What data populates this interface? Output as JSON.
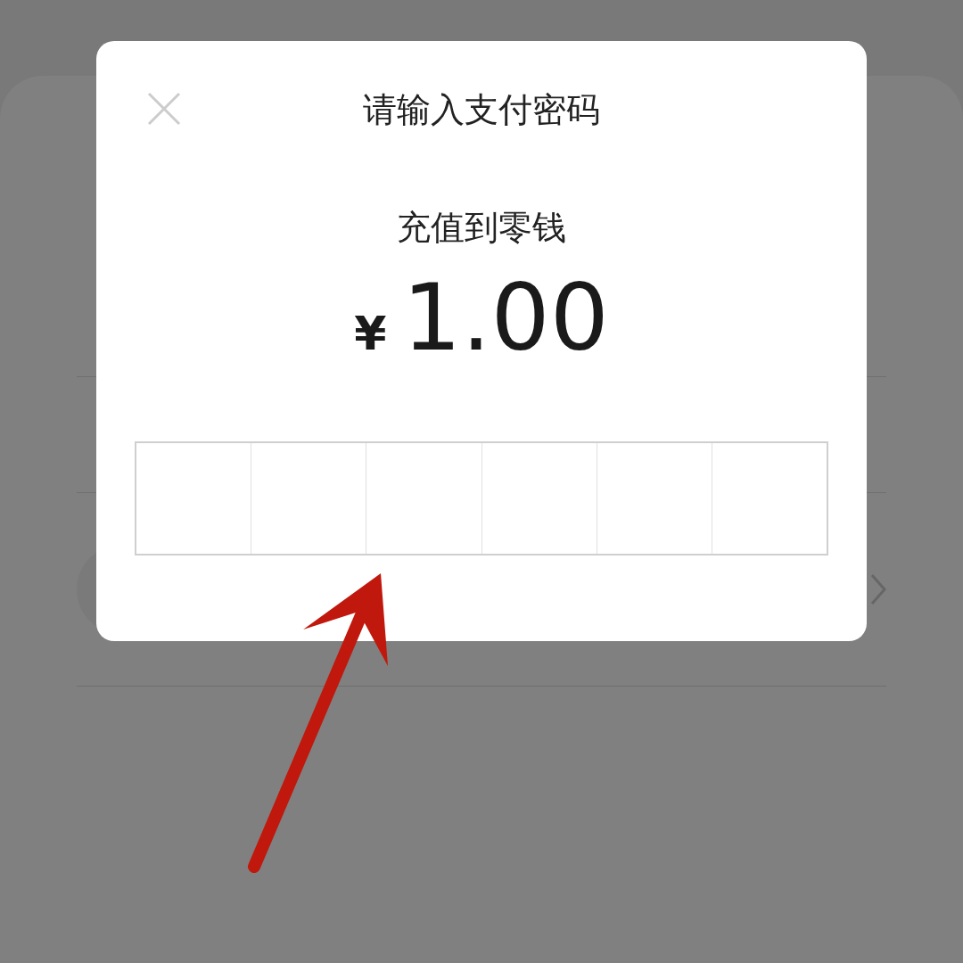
{
  "dialog": {
    "title": "请输入支付密码",
    "subtitle": "充值到零钱",
    "currency": "¥",
    "amount": "1.00",
    "password_cells": [
      {
        "filled": false
      },
      {
        "filled": false
      },
      {
        "filled": false
      },
      {
        "filled": false
      },
      {
        "filled": false
      },
      {
        "filled": false
      }
    ]
  }
}
